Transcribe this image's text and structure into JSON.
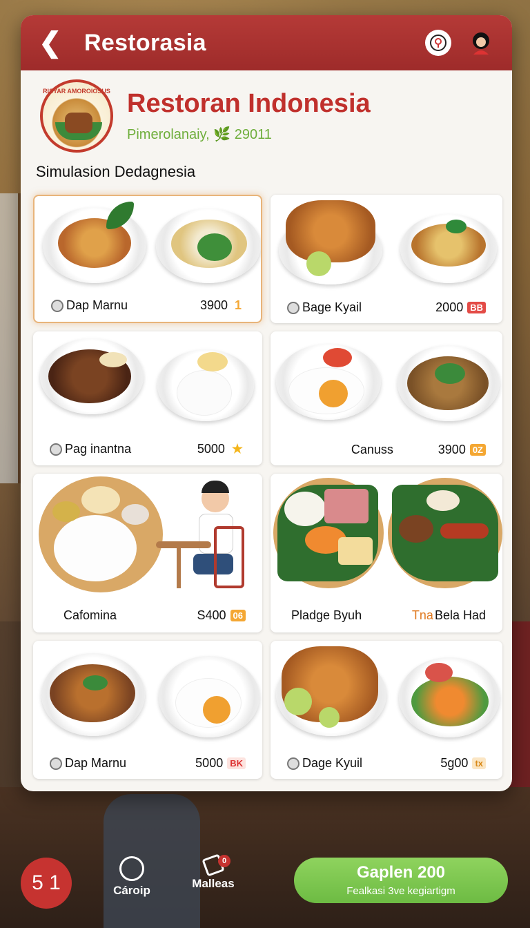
{
  "app": {
    "title": "Restorasia",
    "back_icon": "chevron-left-icon",
    "icons": [
      "location-icon",
      "user-avatar-icon"
    ]
  },
  "restaurant": {
    "name": "Restoran Indonesia",
    "subtitle": "Pimerolanaiy, 🌿 29011",
    "logo_text": "RISYAR AMOROIOSUS"
  },
  "section_title": "Simulasion Dedagnesia",
  "menu": [
    {
      "name": "Dap Marnu",
      "price": "3900",
      "badge": "1",
      "badge_style": "plain",
      "icon": true
    },
    {
      "name": "Bage Kyail",
      "price": "2000",
      "badge": "BB",
      "badge_style": "red",
      "icon": true
    },
    {
      "name": "Pag inantna",
      "price": "5000",
      "badge": "★",
      "badge_style": "star",
      "icon": true
    },
    {
      "name": "Canuss",
      "price": "3900",
      "badge": "0Z",
      "badge_style": "orange",
      "icon": false
    },
    {
      "name": "Cafomina",
      "price": "S400",
      "badge": "06",
      "badge_style": "orange",
      "icon": false
    },
    {
      "name": "Pladge Byuh",
      "price": "",
      "badge": "",
      "badge_style": "",
      "icon": false,
      "alt_label_prefix": "Tna",
      "alt_label": "Bela Had"
    },
    {
      "name": "Dap Marnu",
      "price": "5000",
      "badge": "BK",
      "badge_style": "red",
      "icon": true
    },
    {
      "name": "Dage Kyuil",
      "price": "5g00",
      "badge": "tx",
      "badge_style": "orange",
      "icon": true
    }
  ],
  "bottom": {
    "cart_count": "5 1",
    "nav1_label": "Cároip",
    "nav2_label": "Malleas",
    "nav2_badge": "0",
    "cta_main": "Gaplen 200",
    "cta_sub": "Fealkasi 3ve kegiartigm"
  },
  "colors": {
    "brand_red": "#b53a37",
    "accent_green": "#6dbb43",
    "card_bg": "#f7f5f1"
  }
}
